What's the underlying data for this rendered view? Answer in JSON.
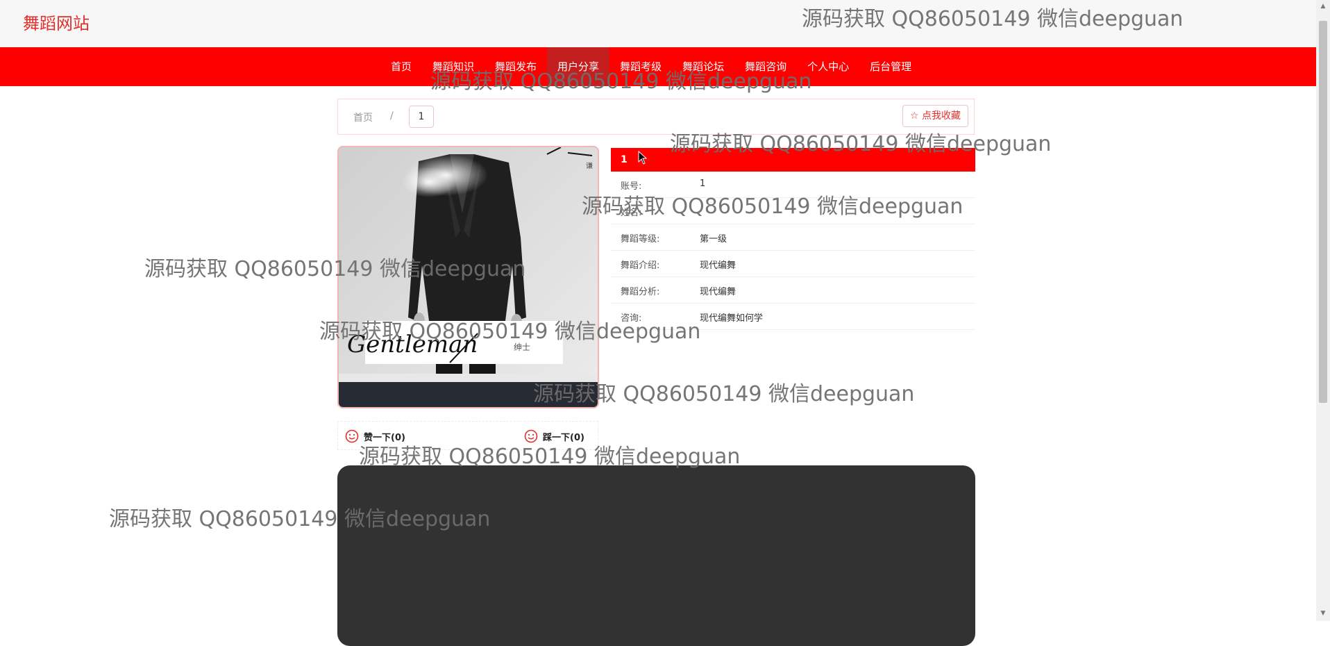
{
  "site": {
    "logo": "舞蹈网站"
  },
  "nav": {
    "items": [
      {
        "label": "首页"
      },
      {
        "label": "舞蹈知识"
      },
      {
        "label": "舞蹈发布"
      },
      {
        "label": "用户分享",
        "active": true
      },
      {
        "label": "舞蹈考级"
      },
      {
        "label": "舞蹈论坛"
      },
      {
        "label": "舞蹈咨询"
      },
      {
        "label": "个人中心"
      },
      {
        "label": "后台管理"
      }
    ]
  },
  "breadcrumb": {
    "home": "首页",
    "separator": "/",
    "current": "1"
  },
  "favorite": {
    "label": "点我收藏",
    "icon": "star-outline-icon"
  },
  "detail": {
    "title": "1",
    "fields": [
      {
        "label": "账号:",
        "value": "1"
      },
      {
        "label": "姓名:",
        "value": ""
      },
      {
        "label": "舞蹈等级:",
        "value": "第一级"
      },
      {
        "label": "舞蹈介绍:",
        "value": "现代编舞"
      },
      {
        "label": "舞蹈分析:",
        "value": "现代编舞"
      },
      {
        "label": "咨询:",
        "value": "现代编舞如何学"
      }
    ]
  },
  "photo": {
    "script_text": "Gentleman",
    "caption": "绅士",
    "corner_text": "谦"
  },
  "votes": {
    "like": {
      "label": "赞一下(0)",
      "icon": "smile-icon"
    },
    "dislike": {
      "label": "踩一下(0)",
      "icon": "smile-icon"
    }
  },
  "watermark": "源码获取 QQ86050149 微信deepguan",
  "colors": {
    "brand_red": "#ff0000",
    "active_nav": "#c41e1e",
    "logo_red": "#e0302e",
    "video_bg": "#323232"
  }
}
